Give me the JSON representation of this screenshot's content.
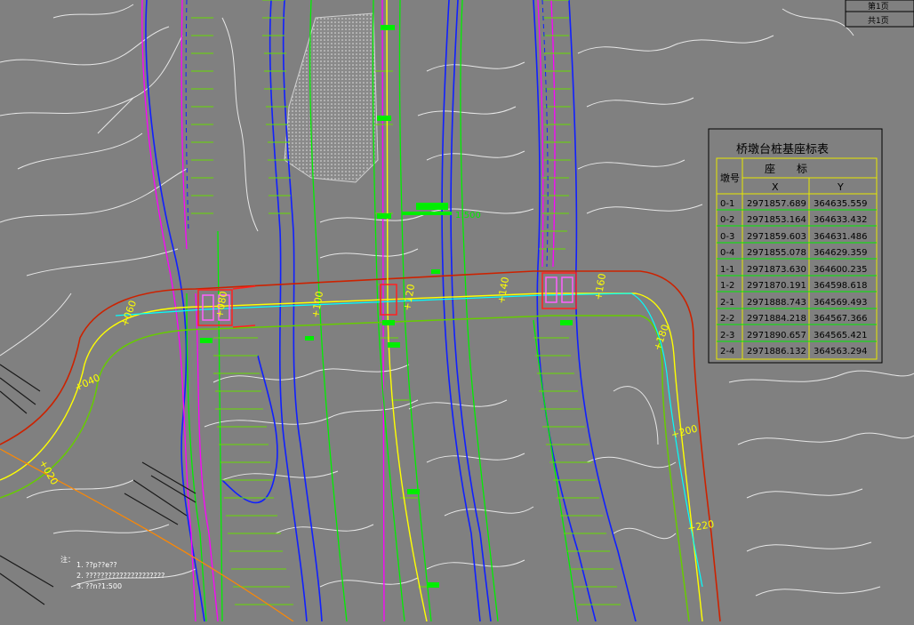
{
  "title_block": {
    "rows": [
      "第1页",
      "共1页"
    ]
  },
  "coord_table": {
    "title": "桥墩台桩基座标表",
    "header_id": "墩号",
    "header_group": "座　　标",
    "header_x": "X",
    "header_y": "Y",
    "rows": [
      {
        "id": "0-1",
        "x": "2971857.689",
        "y": "364635.559"
      },
      {
        "id": "0-2",
        "x": "2971853.164",
        "y": "364633.432"
      },
      {
        "id": "0-3",
        "x": "2971859.603",
        "y": "364631.486"
      },
      {
        "id": "0-4",
        "x": "2971855.078",
        "y": "364629.359"
      },
      {
        "id": "1-1",
        "x": "2971873.630",
        "y": "364600.235"
      },
      {
        "id": "1-2",
        "x": "2971870.191",
        "y": "364598.618"
      },
      {
        "id": "2-1",
        "x": "2971888.743",
        "y": "364569.493"
      },
      {
        "id": "2-2",
        "x": "2971884.218",
        "y": "364567.366"
      },
      {
        "id": "2-3",
        "x": "2971890.657",
        "y": "364565.421"
      },
      {
        "id": "2-4",
        "x": "2971886.132",
        "y": "364563.294"
      }
    ]
  },
  "scale_label": "1:500",
  "stations": [
    "+020",
    "+040",
    "+060",
    "+080",
    "+100",
    "+120",
    "+140",
    "+160",
    "+180",
    "+200",
    "+220"
  ],
  "notes": {
    "heading": "注：",
    "lines": [
      "1. ??p??e??",
      "2. ?????????????????????",
      "3. ??n?1:500 "
    ]
  },
  "colors": {
    "background": "#808080",
    "contour": "#e6e6e6",
    "road_center": "#ffff00",
    "road_edge": "#00ff00",
    "river_edge": "#0000ff",
    "boundary": "#ff00ff",
    "bridge_axis": "#00ffff",
    "outline_red": "#cc2200",
    "embank_green": "#66cc00"
  }
}
